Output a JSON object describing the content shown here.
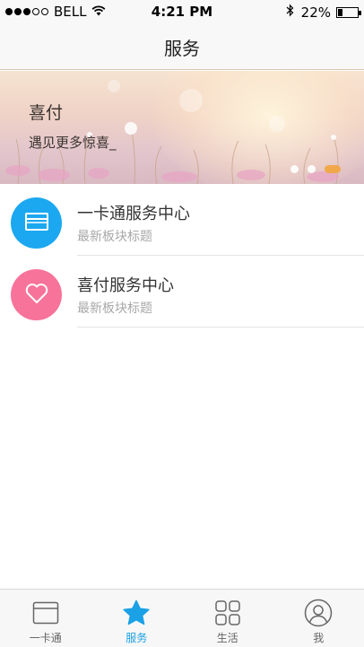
{
  "status_bar": {
    "carrier": "BELL",
    "time": "4:21 PM",
    "battery": "22%",
    "battery_level": 0.22
  },
  "nav": {
    "title": "服务"
  },
  "banner": {
    "title": "喜付",
    "subtitle": "遇见更多惊喜_",
    "pages": 3,
    "active_page": 3
  },
  "services": [
    {
      "title": "一卡通服务中心",
      "subtitle": "最新板块标题",
      "icon": "card-icon",
      "color": "#1ca8f0"
    },
    {
      "title": "喜付服务中心",
      "subtitle": "最新板块标题",
      "icon": "heart-icon",
      "color": "#f7739a"
    }
  ],
  "tabs": [
    {
      "label": "一卡通",
      "icon": "card-icon"
    },
    {
      "label": "服务",
      "icon": "star-icon",
      "active": true
    },
    {
      "label": "生活",
      "icon": "grid-icon"
    },
    {
      "label": "我",
      "icon": "user-icon"
    }
  ],
  "colors": {
    "accent": "#1aa1e6",
    "pager_active": "#f0a84a"
  }
}
